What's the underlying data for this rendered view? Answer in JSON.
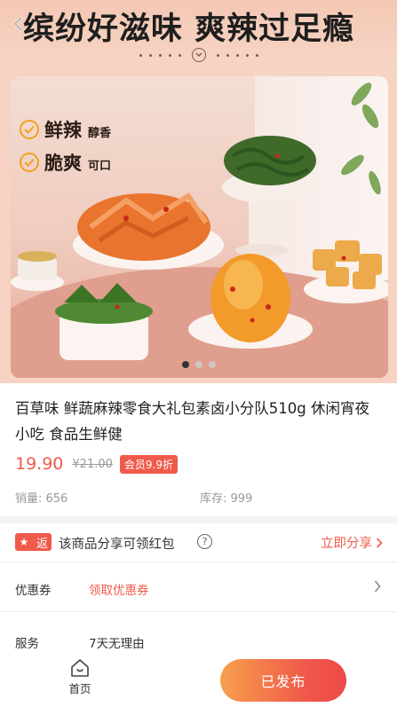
{
  "banner": {
    "headline": "缤纷好滋味 爽辣过足瘾",
    "claims": [
      {
        "big": "鲜辣",
        "small": "醇香"
      },
      {
        "big": "脆爽",
        "small": "可口"
      }
    ],
    "carousel_count": 3,
    "carousel_active": 1
  },
  "product": {
    "title": "百草味 鲜蔬麻辣零食大礼包素卤小分队510g 休闲宵夜小吃 食品生鲜健",
    "price": "19.90",
    "original_price": "¥21.00",
    "member_badge": "会员9.9折",
    "sales": "销量: 656",
    "stock": "库存: 999"
  },
  "share": {
    "badge": "返",
    "text": "该商品分享可领红包",
    "help": "?",
    "action": "立即分享"
  },
  "coupon": {
    "label": "优惠券",
    "value": "领取优惠券"
  },
  "service": {
    "label": "服务",
    "value": "7天无理由"
  },
  "bottom_bar": {
    "home_label": "首页",
    "publish_label": "已发布"
  },
  "colors": {
    "accent": "#f05a4a",
    "banner_bg": "#f6d3c2",
    "claim_check": "#f2a11d"
  },
  "icons": {
    "back": "back-arrow-icon",
    "check": "check-circle-icon",
    "share_star": "star-icon",
    "help": "question-circle-icon",
    "action_chevron": "chevron-right-icon",
    "home": "home-icon"
  }
}
